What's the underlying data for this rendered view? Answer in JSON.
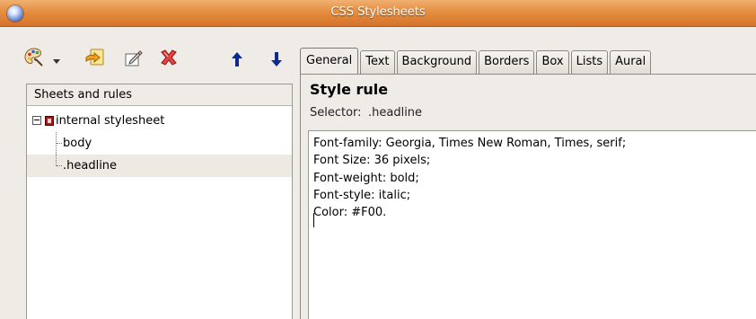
{
  "window": {
    "title": "CSS Stylesheets",
    "icon": "globe-icon"
  },
  "toolbar": {
    "buttons": [
      {
        "icon": "palette-icon",
        "name": "new-style-button"
      },
      {
        "icon": "chevron-down-icon",
        "name": "new-style-menu-button"
      },
      {
        "icon": "import-icon",
        "name": "import-button"
      },
      {
        "icon": "edit-icon",
        "name": "edit-button"
      },
      {
        "icon": "delete-icon",
        "name": "delete-button"
      },
      {
        "icon": "arrow-up-icon",
        "name": "move-up-button"
      },
      {
        "icon": "arrow-down-icon",
        "name": "move-down-button"
      }
    ]
  },
  "left_panel": {
    "header": "Sheets and rules",
    "tree": {
      "root": "internal stylesheet",
      "children": [
        "body",
        ".headline"
      ],
      "selected": ".headline"
    }
  },
  "tabs": [
    "General",
    "Text",
    "Background",
    "Borders",
    "Box",
    "Lists",
    "Aural"
  ],
  "active_tab": "General",
  "rule": {
    "heading": "Style rule",
    "selector_label": "Selector:",
    "selector_value": ".headline",
    "text": "Font-family: Georgia, Times New Roman, Times, serif;\nFont Size: 36 pixels;\nFont-weight: bold;\nFont-style: italic;\nColor: #F00."
  },
  "colors": {
    "titlebar": "#e48e3f",
    "window_bg": "#efebe7",
    "accent_blue": "#1a2c8c",
    "delete_red": "#d22a2a"
  }
}
